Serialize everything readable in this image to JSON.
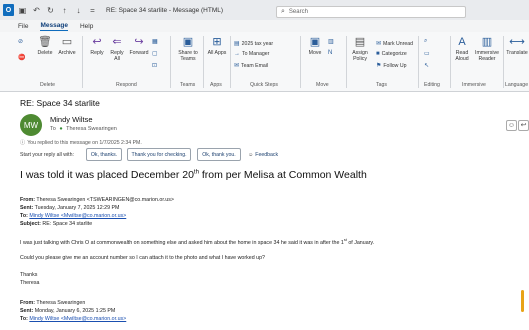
{
  "titlebar": {
    "app_icon": "outlook-icon",
    "title": "RE: Space 34 starlite  -  Message (HTML)",
    "search_placeholder": "Search"
  },
  "menu": {
    "tabs": [
      "File",
      "Message",
      "Help"
    ],
    "active": "Message"
  },
  "ribbon": {
    "delete_group": {
      "delete": "Delete",
      "archive": "Archive",
      "label": "Delete"
    },
    "respond_group": {
      "reply": "Reply",
      "reply_all": "Reply All",
      "forward": "Forward",
      "label": "Respond"
    },
    "teams_group": {
      "share": "Share to Teams",
      "label": "Teams"
    },
    "apps_group": {
      "all_apps": "All Apps",
      "label": "Apps"
    },
    "quick_steps": {
      "item1": "2025 tax year",
      "item2": "To Manager",
      "item3": "Team Email",
      "label": "Quick Steps"
    },
    "move_group": {
      "move": "Move",
      "label": "Move"
    },
    "tags_group": {
      "assign_policy": "Assign Policy",
      "mark_unread": "Mark Unread",
      "categorize": "Categorize",
      "follow_up": "Follow Up",
      "label": "Tags"
    },
    "editing_group": {
      "label": "Editing"
    },
    "immersive_group": {
      "read_aloud": "Read Aloud",
      "immersive_reader": "Immersive Reader",
      "label": "Immersive"
    },
    "language_group": {
      "translate": "Translate",
      "label": "Language"
    }
  },
  "message": {
    "subject": "RE: Space 34 starlite",
    "avatar_initials": "MW",
    "sender": "Mindy Wiltse",
    "to_label": "To",
    "to_name": "Theresa Swearingen",
    "replied_notice": "You replied to this message on 1/7/2025 2:34 PM.",
    "quick_reply_label": "Start your reply all with:",
    "quick_replies": [
      "Ok, thanks.",
      "Thank you for checking.",
      "Ok, thank you."
    ],
    "feedback": "Feedback",
    "headline_main": "I was told it was placed December 20",
    "headline_sup": "th",
    "headline_rest": " from per Melisa at Common Wealth",
    "quoted1": {
      "from_label": "From:",
      "from_value": "Theresa Swearingen <TSWEARINGEN@co.marion.or.us>",
      "sent_label": "Sent:",
      "sent_value": "Tuesday, January 7, 2025 12:29 PM",
      "to_label": "To:",
      "to_value": "Mindy Wiltse <Mwiltse@co.marion.or.us>",
      "subject_label": "Subject:",
      "subject_value": "RE: Space 34 starlite"
    },
    "body_p1_a": "I was just talking with Chris O at commonwealth on something else and asked him about the home in space 34  he said it was in after the 1",
    "body_p1_sup": "st",
    "body_p1_b": " of January.",
    "body_p2": "Could you please give me an account number so I can attach it to the photo and what I have worked up?",
    "thanks": "Thanks",
    "signature": "Theresa",
    "quoted2": {
      "from_label": "From:",
      "from_value": "Theresa Swearingen",
      "sent_label": "Sent:",
      "sent_value": "Monday, January 6, 2025 1:25 PM",
      "to_label": "To:",
      "to_value": "Mindy Wiltse <Mwiltse@co.marion.or.us>"
    }
  },
  "colors": {
    "accent": "#0f6cbd",
    "avatar": "#4e8a32",
    "link": "#1a4fb0"
  }
}
